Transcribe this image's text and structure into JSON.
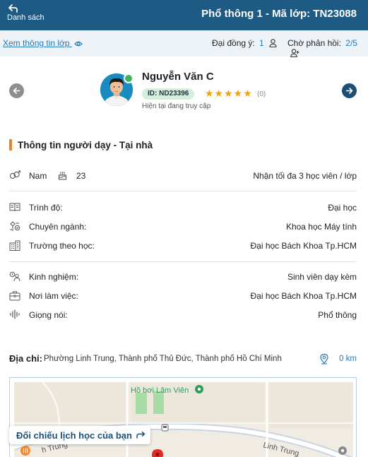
{
  "header": {
    "back_label": "Danh sách",
    "title": "Phổ thông 1 - Mã lớp: TN23088"
  },
  "subbar": {
    "view_class_label": "Xem thông tin lớp",
    "agreed_label": "Đại đồng ý:",
    "agreed_count": "1",
    "waiting_label": "Chờ phản hồi:",
    "waiting_count": "2/5"
  },
  "profile": {
    "name": "Nguyễn Văn C",
    "id_badge": "ID: ND23396",
    "stars": "★★★★★",
    "rating_count": "(0)",
    "rating_value": 5,
    "online_text": "Hiện tại đang truy cập"
  },
  "section": {
    "title": "Thông tin người dạy - Tại nhà"
  },
  "basic": {
    "gender": "Nam",
    "age": "23",
    "capacity": "Nhận tối đa 3 học viên / lớp"
  },
  "education": [
    {
      "icon": "book-icon",
      "label": "Trình độ:",
      "value": "Đại học"
    },
    {
      "icon": "major-icon",
      "label": "Chuyên ngành:",
      "value": "Khoa học Máy tính"
    },
    {
      "icon": "building-icon",
      "label": "Trường theo học:",
      "value": "Đại học Bách Khoa Tp.HCM"
    }
  ],
  "work": [
    {
      "icon": "experience-icon",
      "label": "Kinh nghiệm:",
      "value": "Sinh viên dạy kèm"
    },
    {
      "icon": "briefcase-icon",
      "label": "Nơi làm việc:",
      "value": "Đại học Bách Khoa Tp.HCM"
    },
    {
      "icon": "voice-icon",
      "label": "Giọng nói:",
      "value": "Phổ thông"
    }
  ],
  "address": {
    "label": "Địa chỉ:",
    "text": "Phường Linh Trung, Thành phố Thủ Đức, Thành phố Hồ Chí Minh",
    "distance": "0 km"
  },
  "map": {
    "poi_label": "Hồ bơi Lâm Viên",
    "street_label": "Linh Trung",
    "street_label_left": "h Trung",
    "button_label": "Đối chiếu lịch học của bạn"
  },
  "colors": {
    "header": "#1d5a84",
    "accent": "#2479b8",
    "section_marker": "#e8822c",
    "star": "#f2a20c",
    "online": "#3fb35a"
  }
}
